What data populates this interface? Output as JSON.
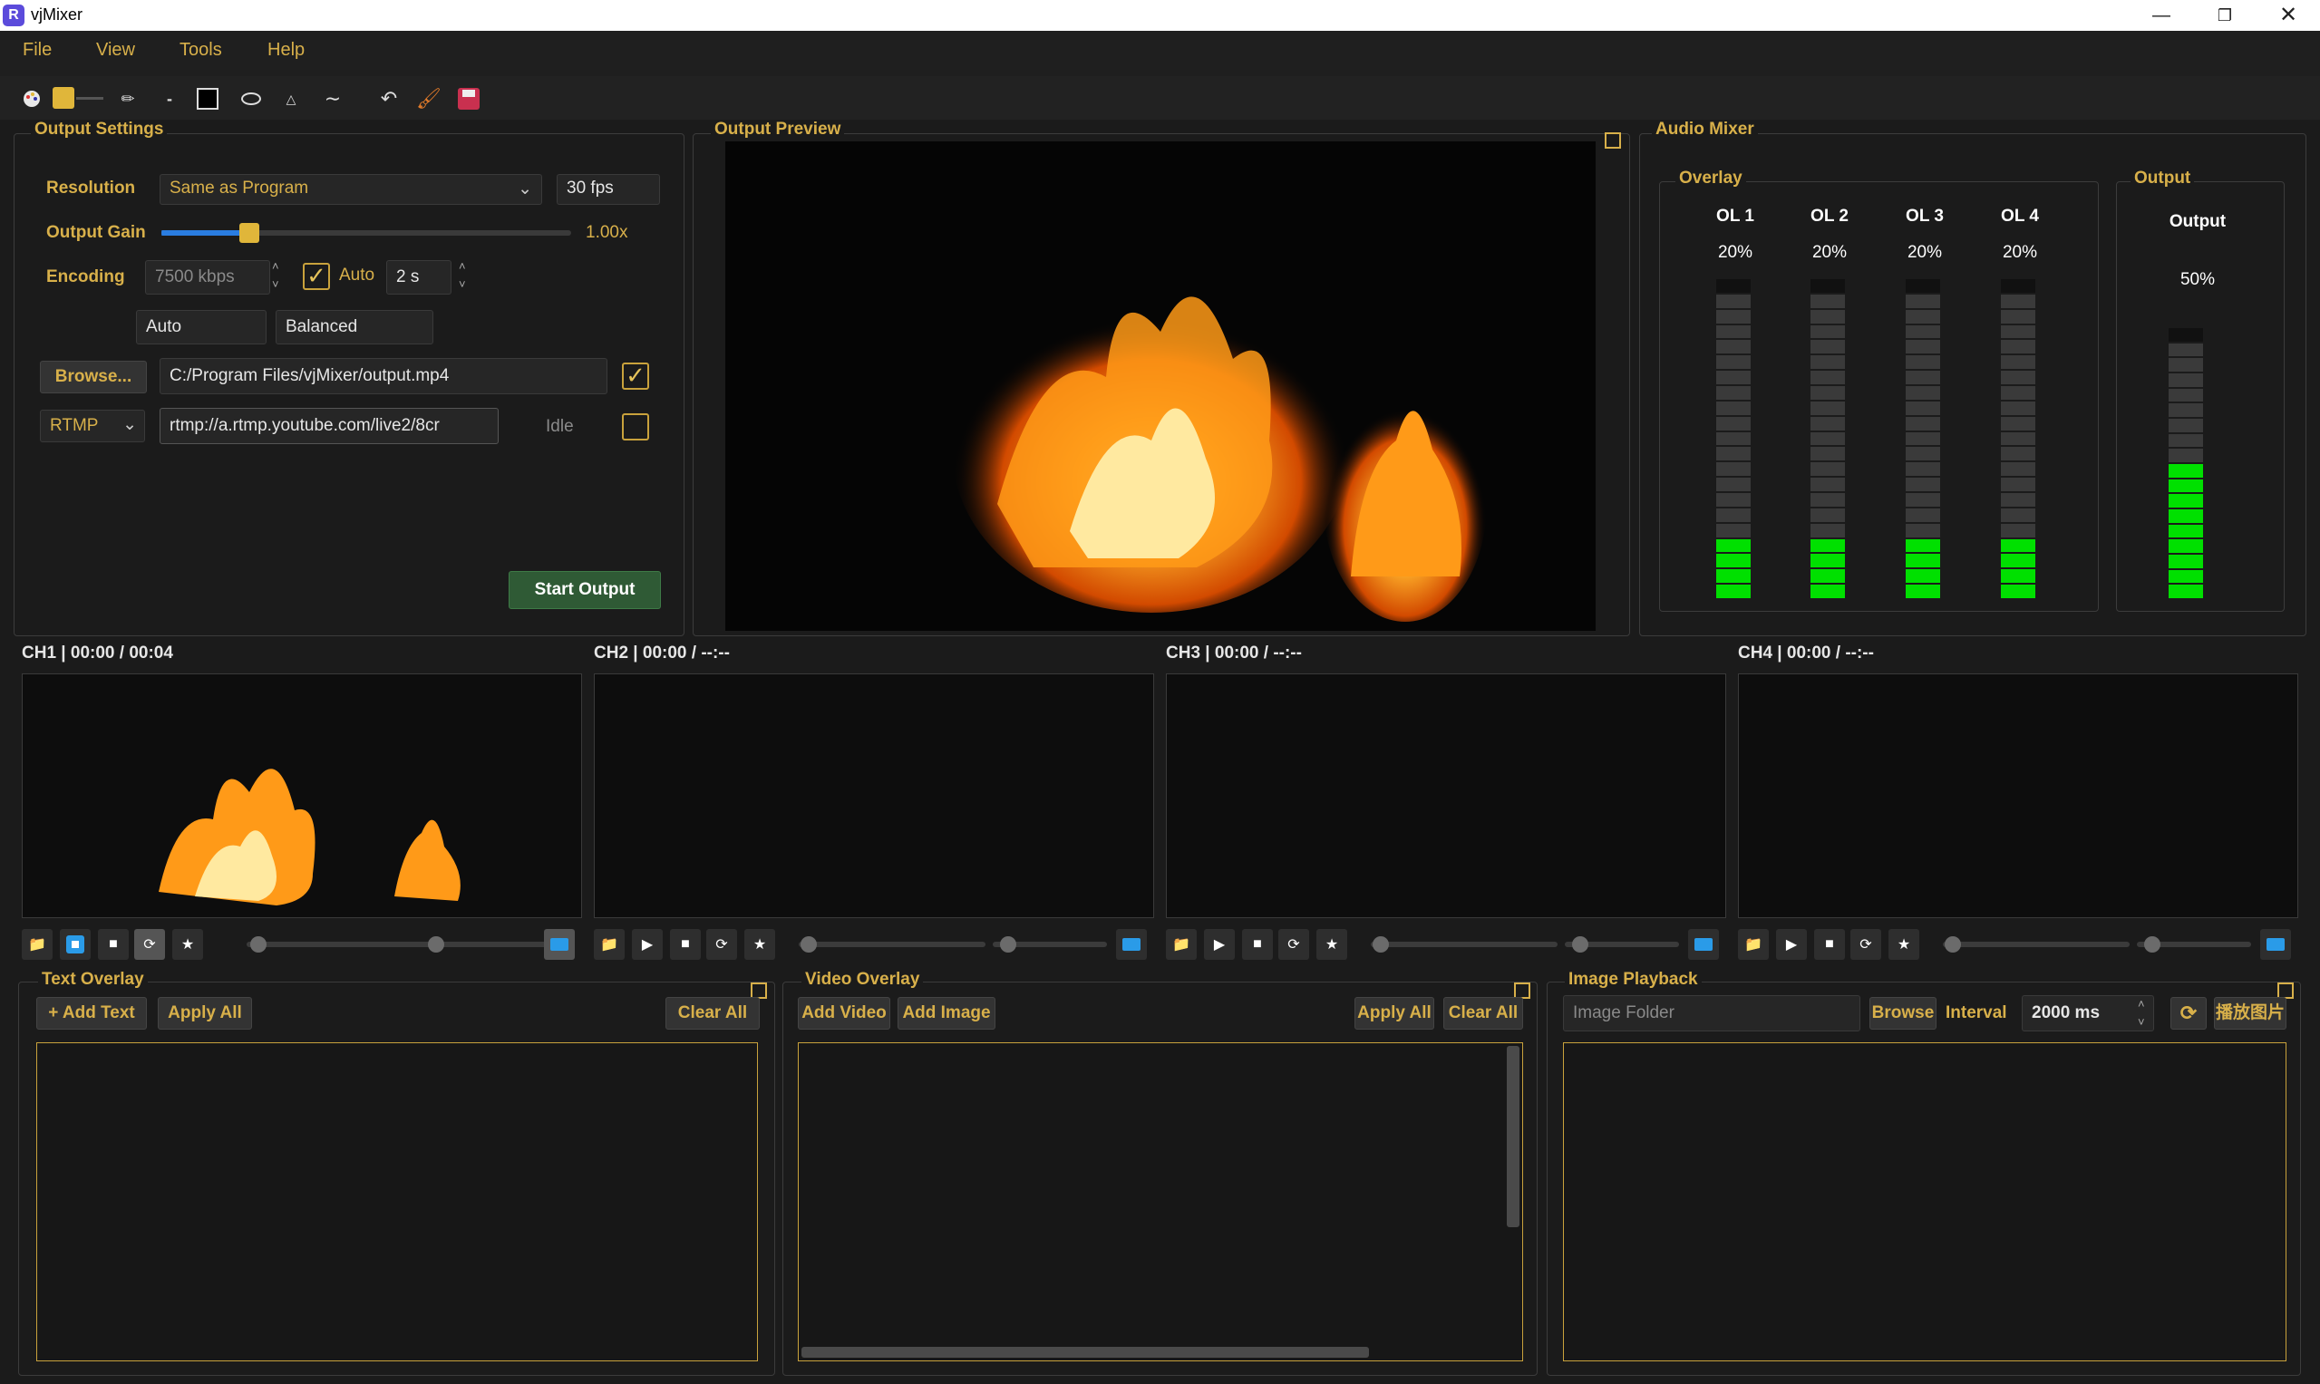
{
  "window": {
    "title": "vjMixer",
    "logo_letter": "R"
  },
  "menu": {
    "items": [
      "File",
      "View",
      "Tools",
      "Help"
    ]
  },
  "toolbar": {
    "icons": [
      "palette-icon",
      "color-swatch-icon",
      "pen-icon",
      "line-icon",
      "fill-square-icon",
      "ellipse-icon",
      "triangle-icon",
      "wave-icon",
      "undo-icon",
      "brush-icon",
      "save-icon"
    ],
    "swatch_color": "#e0b63a"
  },
  "output_settings": {
    "title": "Output Settings",
    "resolution_label": "Resolution",
    "resolution_value": "Same as Program",
    "fps": "30 fps",
    "gain_label": "Output Gain",
    "gain_value": "1.00x",
    "gain_level": 0.2,
    "encoding_label": "Encoding",
    "bitrate": "7500 kbps",
    "auto_label": "Auto",
    "keyframe": "2 s",
    "encoder": "Auto",
    "preset": "Balanced",
    "browse_label": "Browse...",
    "output_path": "C:/Program Files/vjMixer/output.mp4",
    "protocol": "RTMP",
    "stream_url": "rtmp://a.rtmp.youtube.com/live2/8cr",
    "status": "Idle",
    "start_label": "Start Output"
  },
  "preview": {
    "title": "Output Preview"
  },
  "audio_mixer": {
    "title": "Audio Mixer",
    "overlay_title": "Overlay",
    "output_group_title": "Output",
    "channels": [
      {
        "name": "OL 1",
        "level": "20%"
      },
      {
        "name": "OL 2",
        "level": "20%"
      },
      {
        "name": "OL 3",
        "level": "20%"
      },
      {
        "name": "OL 4",
        "level": "20%"
      }
    ],
    "output": {
      "name": "Output",
      "level": "50%"
    },
    "active_color": "#00e000",
    "inactive_color": "#3a3a3a"
  },
  "channels": [
    {
      "title": "CH1 | 00:00 / 00:04"
    },
    {
      "title": "CH2 | 00:00 / --:--"
    },
    {
      "title": "CH3 | 00:00 / --:--"
    },
    {
      "title": "CH4 | 00:00 / --:--"
    }
  ],
  "text_overlay": {
    "title": "Text Overlay",
    "add": "+ Add Text",
    "apply": "Apply All",
    "clear": "Clear All"
  },
  "video_overlay": {
    "title": "Video Overlay",
    "add_video": "Add Video",
    "add_image": "Add Image",
    "apply": "Apply All",
    "clear": "Clear All"
  },
  "image_playback": {
    "title": "Image Playback",
    "folder_placeholder": "Image Folder",
    "browse": "Browse",
    "interval_label": "Interval",
    "interval_value": "2000 ms",
    "play": "播放图片"
  }
}
